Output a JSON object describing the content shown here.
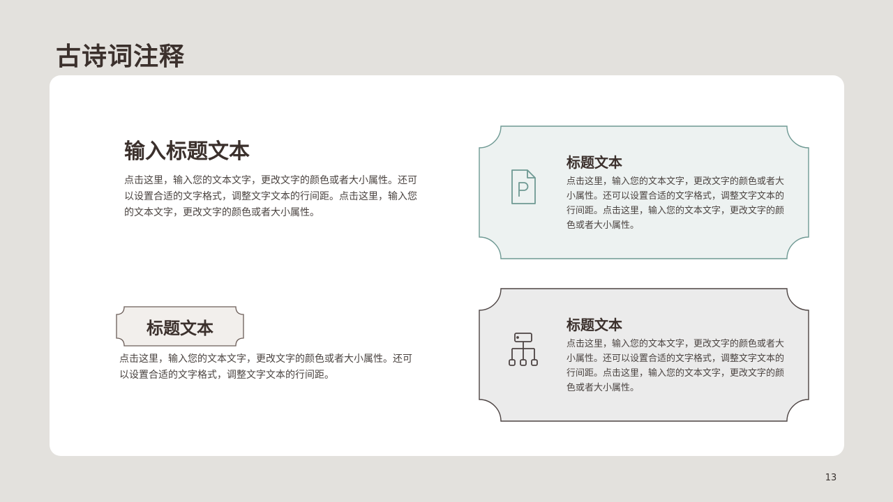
{
  "slide": {
    "title": "古诗词注释",
    "page_number": "13"
  },
  "main_block": {
    "heading": "输入标题文本",
    "text": "点击这里，输入您的文本文字，更改文字的颜色或者大小属性。还可以设置合适的文字格式，调整文字文本的行间距。点击这里，输入您的文本文字，更改文字的颜色或者大小属性。"
  },
  "tag_block": {
    "label": "标题文本",
    "text": "点击这里，输入您的文本文字，更改文字的颜色或者大小属性。还可以设置合适的文字格式，调整文字文本的行间距。"
  },
  "cards": [
    {
      "title": "标题文本",
      "text": "点击这里，输入您的文本文字，更改文字的颜色或者大小属性。还可以设置合适的文字格式，调整文字文本的行间距。点击这里，输入您的文本文字，更改文字的颜色或者大小属性。",
      "icon": "document-p-icon",
      "fill": "#edf2f1",
      "stroke": "#6e9993"
    },
    {
      "title": "标题文本",
      "text": "点击这里，输入您的文本文字，更改文字的颜色或者大小属性。还可以设置合适的文字格式，调整文字文本的行间距。点击这里，输入您的文本文字，更改文字的颜色或者大小属性。",
      "icon": "hierarchy-icon",
      "fill": "#ebebeb",
      "stroke": "#4d4443"
    }
  ],
  "colors": {
    "background": "#e3e1dd",
    "panel": "#ffffff",
    "heading": "#3b302c",
    "tag_fill": "#f2efec",
    "tag_stroke": "#6b5d58"
  }
}
